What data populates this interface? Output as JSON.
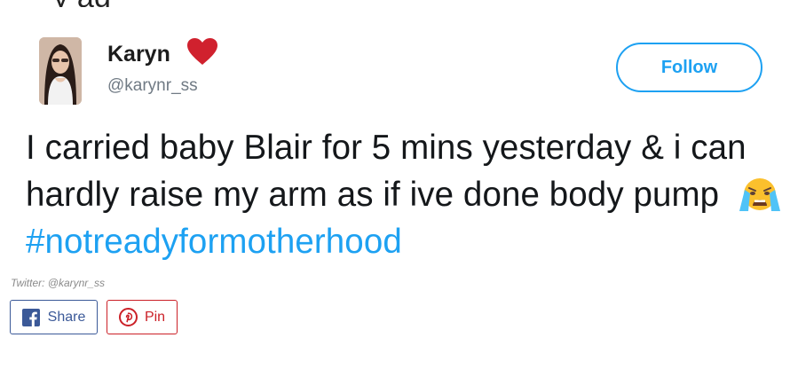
{
  "top_text": "y ag ",
  "tweet": {
    "author_name": "Karyn",
    "author_handle": "@karynr_ss",
    "follow_label": "Follow",
    "text_main": "I carried baby Blair for 5 mins yesterday & i can hardly raise my arm as if ive done body pump",
    "emoji": "crying-face-emoji",
    "hashtag": "#notreadyformotherhood",
    "colors": {
      "accent": "#1da1f2",
      "heart": "#d0212e"
    }
  },
  "credit": "Twitter: @karynr_ss",
  "share": {
    "share_label": "Share",
    "share_icon": "facebook-icon",
    "share_color": "#3b5998",
    "pin_label": "Pin",
    "pin_icon": "pinterest-icon",
    "pin_color": "#cb2027"
  }
}
